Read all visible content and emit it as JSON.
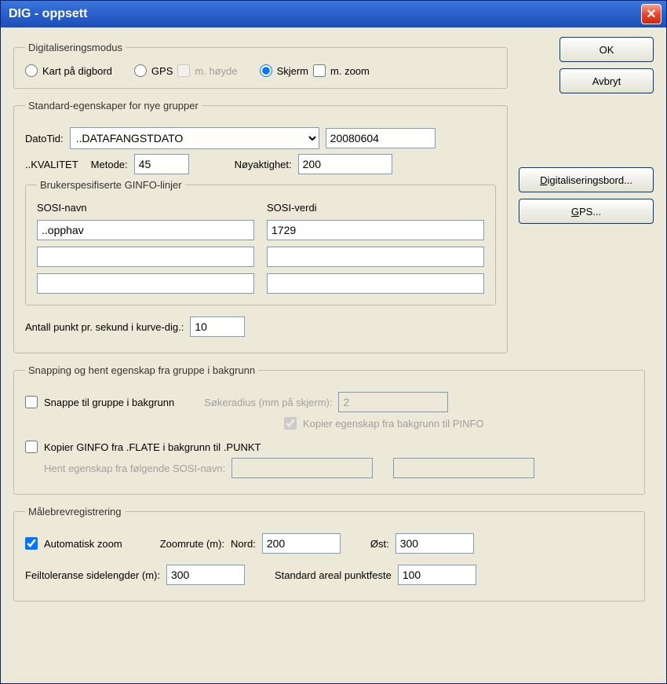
{
  "window": {
    "title": "DIG - oppsett"
  },
  "buttons": {
    "ok": "OK",
    "cancel": "Avbryt",
    "digibord": "Digitaliseringsbord...",
    "gps": "GPS..."
  },
  "digmode": {
    "legend": "Digitaliseringsmodus",
    "kart": "Kart på digbord",
    "gps": "GPS",
    "mhoyde": "m. høyde",
    "skjerm": "Skjerm",
    "mzoom": "m. zoom"
  },
  "stdprops": {
    "legend": "Standard-egenskaper for nye grupper",
    "datotid_label": "DatoTid:",
    "datotid_value": "..DATAFANGSTDATO",
    "dato_val": "20080604",
    "kvalitet": "..KVALITET",
    "metode_label": "Metode:",
    "metode_val": "45",
    "noyakt_label": "Nøyaktighet:",
    "noyakt_val": "200",
    "antall_label": "Antall punkt pr. sekund i kurve-dig.:",
    "antall_val": "10"
  },
  "ginfo": {
    "legend": "Brukerspesifiserte GINFO-linjer",
    "sosi_navn": "SOSI-navn",
    "sosi_verdi": "SOSI-verdi",
    "navn1": "..opphav",
    "verdi1": "1729",
    "navn2": "",
    "verdi2": "",
    "navn3": "",
    "verdi3": ""
  },
  "snapping": {
    "legend": "Snapping og hent egenskap fra gruppe i bakgrunn",
    "snappe": "Snappe til gruppe i bakgrunn",
    "sokeradius_label": "Søkeradius (mm på skjerm):",
    "sokeradius_val": "2",
    "kopier_egenskap": "Kopier egenskap fra bakgrunn til PINFO",
    "kopier_ginfo": "Kopier GINFO fra .FLATE i bakgrunn til .PUNKT",
    "hent_egenskap": "Hent egenskap fra følgende SOSI-navn:",
    "hent1": "",
    "hent2": ""
  },
  "malebrev": {
    "legend": "Målebrevregistrering",
    "auto_zoom": "Automatisk zoom",
    "zoomrute": "Zoomrute (m):",
    "nord_label": "Nord:",
    "nord_val": "200",
    "ost_label": "Øst:",
    "ost_val": "300",
    "feiltoleranse": "Feiltoleranse sidelengder (m):",
    "feiltol_val": "300",
    "std_areal": "Standard areal punktfeste",
    "std_areal_val": "100"
  }
}
